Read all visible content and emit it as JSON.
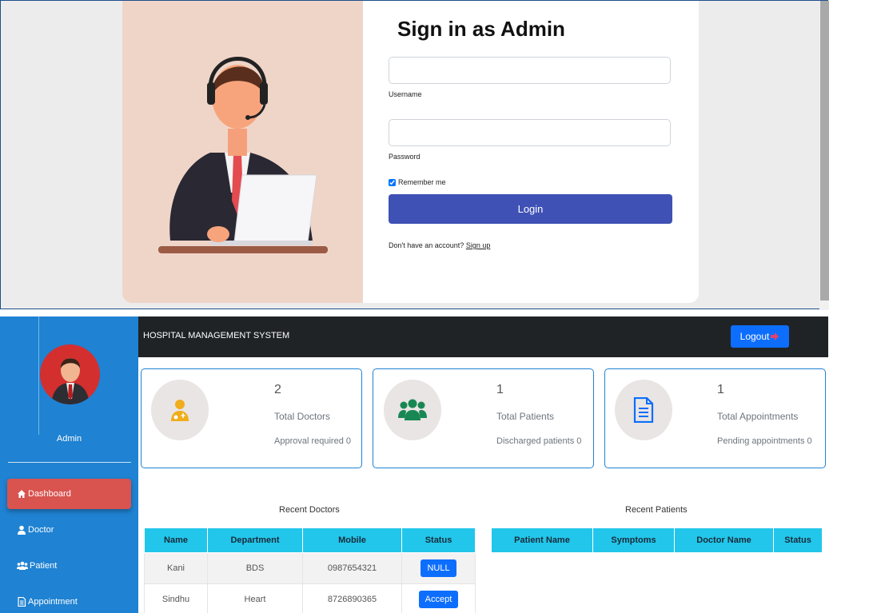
{
  "login": {
    "title": "Sign in as Admin",
    "username_label": "Username",
    "username_value": "",
    "password_label": "Password",
    "password_value": "",
    "remember_label": "Remember me",
    "remember_checked": true,
    "login_button": "Login",
    "signup_prompt": "Don't have an account?",
    "signup_link": "Sign up"
  },
  "sidebar": {
    "admin_name": "Admin",
    "items": [
      {
        "label": "Dashboard",
        "icon": "home-icon",
        "active": true
      },
      {
        "label": "Doctor",
        "icon": "user-doctor-icon",
        "active": false
      },
      {
        "label": "Patient",
        "icon": "users-icon",
        "active": false
      },
      {
        "label": "Appointment",
        "icon": "file-icon",
        "active": false
      }
    ]
  },
  "header": {
    "brand": "HOSPITAL MANAGEMENT SYSTEM",
    "logout_label": "Logout"
  },
  "stats": [
    {
      "value": "2",
      "label": "Total Doctors",
      "sub": "Approval required 0",
      "icon": "doctor-icon",
      "icon_color": "#f0ad1c"
    },
    {
      "value": "1",
      "label": "Total Patients",
      "sub": "Discharged patients 0",
      "icon": "users-icon",
      "icon_color": "#198754"
    },
    {
      "value": "1",
      "label": "Total Appointments",
      "sub": "Pending appointments 0",
      "icon": "file-icon",
      "icon_color": "#0d6efd"
    }
  ],
  "recent_doctors": {
    "title": "Recent Doctors",
    "columns": [
      "Name",
      "Department",
      "Mobile",
      "Status"
    ],
    "rows": [
      {
        "name": "Kani",
        "department": "BDS",
        "mobile": "0987654321",
        "status": "NULL"
      },
      {
        "name": "Sindhu",
        "department": "Heart",
        "mobile": "8726890365",
        "status": "Accept"
      }
    ]
  },
  "recent_patients": {
    "title": "Recent Patients",
    "columns": [
      "Patient Name",
      "Symptoms",
      "Doctor Name",
      "Status"
    ]
  },
  "colors": {
    "sidebar": "#1f82d2",
    "active_nav": "#d9534f",
    "topbar": "#202326",
    "login_button": "#3f51b5",
    "table_header": "#22c6ea",
    "accent_button": "#0d6efd"
  }
}
